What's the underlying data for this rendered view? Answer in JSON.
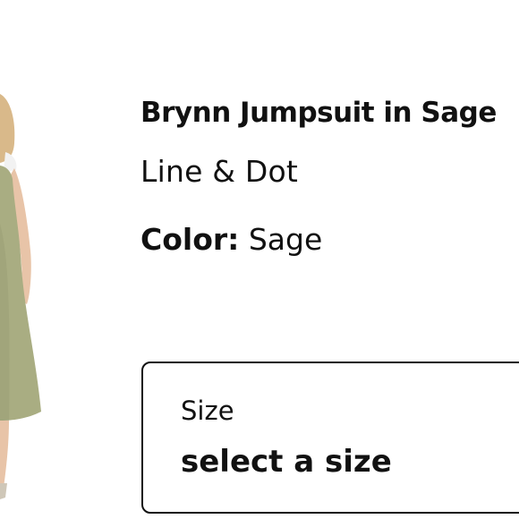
{
  "product": {
    "title": "Brynn Jumpsuit in Sage",
    "brand": "Line & Dot",
    "color_label": "Color:",
    "color_value": "Sage"
  },
  "size_selector": {
    "label": "Size",
    "value": "select a size"
  },
  "colors": {
    "text": "#111111",
    "border": "#111111",
    "garment": "#a9ad82",
    "skin": "#e8c4a8",
    "hair": "#d9b98a"
  }
}
